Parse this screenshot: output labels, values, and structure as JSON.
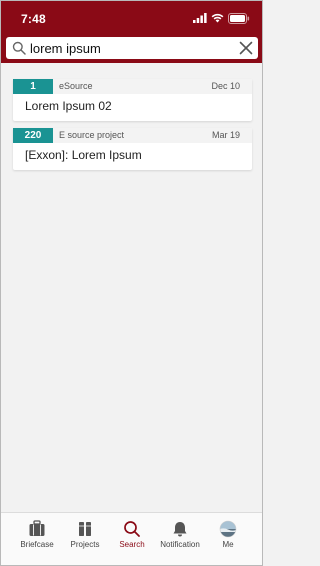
{
  "status_bar": {
    "time": "7:48"
  },
  "search": {
    "query": "lorem ipsum",
    "clear_icon": "close-icon",
    "search_icon": "search-icon"
  },
  "results": [
    {
      "count": "1",
      "source": "eSource",
      "date": "Dec 10",
      "title": "Lorem Ipsum 02"
    },
    {
      "count": "220",
      "source": "E source project",
      "date": "Mar 19",
      "title": "[Exxon]: Lorem Ipsum"
    }
  ],
  "tabs": [
    {
      "label": "Briefcase",
      "icon": "briefcase-icon",
      "active": false
    },
    {
      "label": "Projects",
      "icon": "projects-icon",
      "active": false
    },
    {
      "label": "Search",
      "icon": "search-icon",
      "active": true
    },
    {
      "label": "Notification",
      "icon": "bell-icon",
      "active": false
    },
    {
      "label": "Me",
      "icon": "avatar",
      "active": false
    }
  ],
  "colors": {
    "brand": "#8a0a16",
    "badge": "#1a9393",
    "background": "#f2f2f2"
  }
}
